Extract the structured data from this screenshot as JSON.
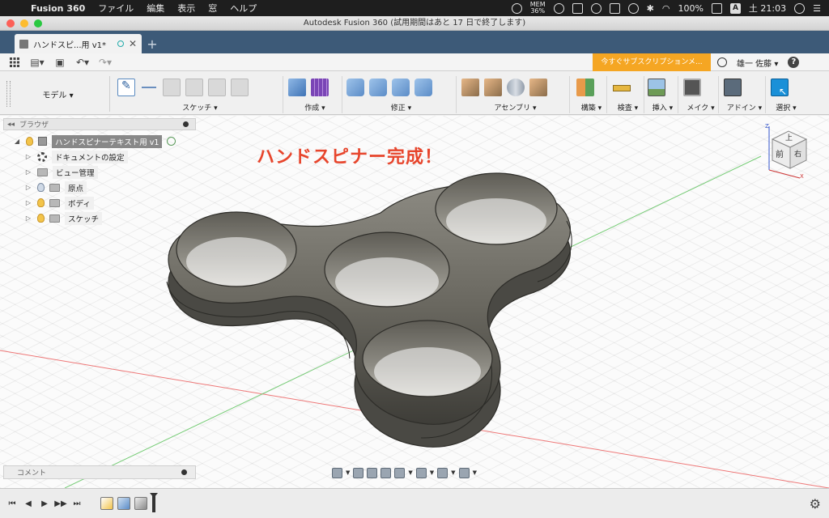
{
  "menubar": {
    "app_name": "Fusion 360",
    "items": [
      "ファイル",
      "編集",
      "表示",
      "窓",
      "ヘルプ"
    ],
    "mem_label": "MEM",
    "mem_value": "36%",
    "battery": "100%",
    "input_mode": "A",
    "clock": "土 21:03"
  },
  "window": {
    "title": "Autodesk Fusion 360 (試用期間はあと 17 日で終了します)"
  },
  "doc_tab": {
    "name": "ハンドスピ...用 v1*",
    "close": "✕",
    "new_tab": "+"
  },
  "quick_access": {
    "subscription_button": "今すぐサブスクリプションメ...",
    "user": "雄一 佐藤 ▾",
    "help": "?"
  },
  "ribbon": {
    "workspace": "モデル ▾",
    "groups": [
      {
        "label": "スケッチ ▾"
      },
      {
        "label": "作成 ▾"
      },
      {
        "label": "修正 ▾"
      },
      {
        "label": "アセンブリ ▾"
      },
      {
        "label": "構築 ▾"
      },
      {
        "label": "検査 ▾"
      },
      {
        "label": "挿入 ▾"
      },
      {
        "label": "メイク ▾"
      },
      {
        "label": "アドイン ▾"
      },
      {
        "label": "選択 ▾"
      }
    ]
  },
  "browser": {
    "title": "ブラウザ",
    "root": "ハンドスピナーテキスト用 v1",
    "items": [
      {
        "label": "ドキュメントの設定",
        "icon": "gear-icon"
      },
      {
        "label": "ビュー管理",
        "icon": "folder-icon"
      },
      {
        "label": "原点",
        "icon": "folder-icon"
      },
      {
        "label": "ボディ",
        "icon": "folder-icon"
      },
      {
        "label": "スケッチ",
        "icon": "folder-icon"
      }
    ]
  },
  "canvas": {
    "headline": "ハンドスピナー完成！",
    "viewcube": {
      "top": "上",
      "front": "前",
      "right": "右",
      "axis_x": "X",
      "axis_z": "Z"
    },
    "colors": {
      "body": "#6a6a62",
      "headline": "#e7452c"
    }
  },
  "comment_bar": {
    "label": "コメント"
  },
  "timeline": {
    "buttons": [
      "⏮",
      "◀",
      "▶",
      "▶▶",
      "⏭"
    ]
  }
}
